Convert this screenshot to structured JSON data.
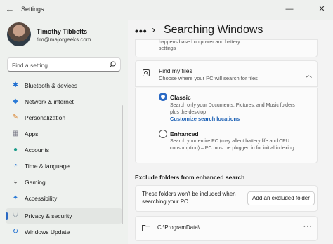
{
  "window": {
    "title": "Settings",
    "controls": {
      "minimize": "—",
      "maximize": "☐",
      "close": "✕"
    }
  },
  "user": {
    "name": "Timothy Tibbetts",
    "email": "tim@majorgeeks.com"
  },
  "search": {
    "placeholder": "Find a setting"
  },
  "sidebar": {
    "items": [
      {
        "label": "Bluetooth & devices",
        "icon": "bluetooth-icon"
      },
      {
        "label": "Network & internet",
        "icon": "wifi-icon"
      },
      {
        "label": "Personalization",
        "icon": "brush-icon"
      },
      {
        "label": "Apps",
        "icon": "apps-icon"
      },
      {
        "label": "Accounts",
        "icon": "person-icon"
      },
      {
        "label": "Time & language",
        "icon": "globe-clock-icon"
      },
      {
        "label": "Gaming",
        "icon": "gamepad-icon"
      },
      {
        "label": "Accessibility",
        "icon": "accessibility-icon"
      },
      {
        "label": "Privacy & security",
        "icon": "shield-icon",
        "selected": true
      },
      {
        "label": "Windows Update",
        "icon": "update-icon"
      }
    ]
  },
  "header": {
    "breadcrumb_more": "•••",
    "separator": "›",
    "title": "Searching Windows"
  },
  "top_card": {
    "partial_text_1": "happens based on power and battery",
    "partial_text_2": "settings"
  },
  "find_my_files": {
    "title": "Find my files",
    "description": "Choose where your PC will search for files",
    "options": [
      {
        "title": "Classic",
        "desc_line1": "Search only your Documents, Pictures, and Music folders",
        "desc_line2": "plus the desktop",
        "link": "Customize search locations",
        "selected": true
      },
      {
        "title": "Enhanced",
        "desc_line1": "Search your entire PC (may affect battery life and CPU",
        "desc_line2": "consumption) – PC must be plugged in for initial indexing",
        "selected": false
      }
    ]
  },
  "exclude": {
    "heading": "Exclude folders from enhanced search",
    "desc_line1": "These folders won't be included when",
    "desc_line2": "searching your PC",
    "add_button": "Add an excluded folder",
    "folders": [
      {
        "path": "C:\\ProgramData\\"
      }
    ],
    "more": "···"
  },
  "colors": {
    "accent": "#2a69c4",
    "link": "#1a5fb4"
  }
}
